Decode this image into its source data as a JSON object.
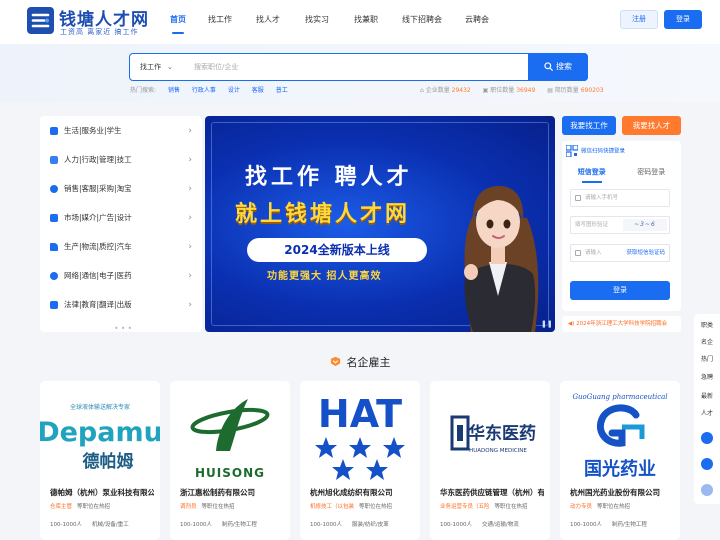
{
  "brand": {
    "name": "钱塘人才网",
    "slogan": "工资高 离家近 搞工作",
    "primary_color": "#1a6cf0",
    "accent_color": "#ff7a2e"
  },
  "nav": {
    "items": [
      "首页",
      "找工作",
      "找人才",
      "找实习",
      "找兼职",
      "线下招聘会",
      "云聘会"
    ],
    "active": "首页"
  },
  "header": {
    "register": "注册",
    "login": "登录"
  },
  "search": {
    "type": "找工作",
    "placeholder": "搜索职位/企业",
    "button": "搜索",
    "hot_label": "热门搜索:",
    "hot_words": [
      "销售",
      "行政人事",
      "设计",
      "客服",
      "普工"
    ]
  },
  "stats": [
    {
      "label": "企业数量",
      "value": "29432"
    },
    {
      "label": "职位数量",
      "value": "36949"
    },
    {
      "label": "简历数量",
      "value": "690203"
    }
  ],
  "categories": [
    {
      "label": "生活|服务业|学生",
      "icon": "service-icon"
    },
    {
      "label": "人力|行政|管理|技工",
      "icon": "building-icon"
    },
    {
      "label": "销售|客服|采购|淘宝",
      "icon": "shopping-icon"
    },
    {
      "label": "市场|媒介|广告|设计",
      "icon": "monitor-icon"
    },
    {
      "label": "生产|物流|质控|汽车",
      "icon": "car-icon"
    },
    {
      "label": "网络|通信|电子|医药",
      "icon": "network-icon"
    },
    {
      "label": "法律|教育|翻译|出版",
      "icon": "book-icon"
    }
  ],
  "banner": {
    "line1": "找工作 聘人才",
    "line2": "就上钱塘人才网",
    "pill": "2024全新版本上线",
    "line3": "功能更强大 招人更高效"
  },
  "login": {
    "find_job": "我要找工作",
    "find_talent": "我要找人才",
    "qr_tip": "微信扫码快捷登录",
    "tabs": [
      "短信登录",
      "密码登录"
    ],
    "active_tab": "短信登录",
    "phone_placeholder": "请输入手机号",
    "captcha_placeholder": "填写图形验证",
    "captcha_text": "~3~6",
    "code_placeholder": "请输入",
    "get_code": "获取短信验证码",
    "submit": "登录"
  },
  "notice": "2024年浙江理工大学科技学院招聘会",
  "side_float": [
    "职类",
    "名企",
    "热门",
    "急聘",
    "最新",
    "人才"
  ],
  "famous": {
    "title": "名企雇主"
  },
  "companies": [
    {
      "name": "德帕姆（杭州）泵业科技有限公司",
      "logo_text": "Depamu",
      "logo_cn": "德帕姆",
      "logo_tag": "全球液体输送解决专家",
      "industry": "仓库主管",
      "jobs": "等职位在热招",
      "size": "100-1000人",
      "category": "机械/设备/重工"
    },
    {
      "name": "浙江惠松制药有限公司",
      "logo_text": "HUISONG",
      "industry": "调剂员",
      "jobs": "等职位在热招",
      "size": "100-1000人",
      "category": "制药/生物工程"
    },
    {
      "name": "杭州旭化成纺织有限公司",
      "logo_text": "HAT",
      "industry": "机修技工（以包装",
      "jobs": "等职位在热招",
      "size": "100-1000人",
      "category": "服装/纺织/皮革"
    },
    {
      "name": "华东医药供应链管理（杭州）有限公司",
      "logo_text": "华东医药",
      "logo_en": "HUADONG MEDICINE",
      "industry": "业务运营专员（五险",
      "jobs": "等职位在热招",
      "size": "100-1000人",
      "category": "交通/运输/物流"
    },
    {
      "name": "杭州国光药业股份有限公司",
      "logo_text": "国光药业",
      "logo_en": "GuoGuang pharmaceutical",
      "industry": "动力专员",
      "jobs": "等职位在热招",
      "size": "100-1000人",
      "category": "制药/生物工程"
    }
  ]
}
